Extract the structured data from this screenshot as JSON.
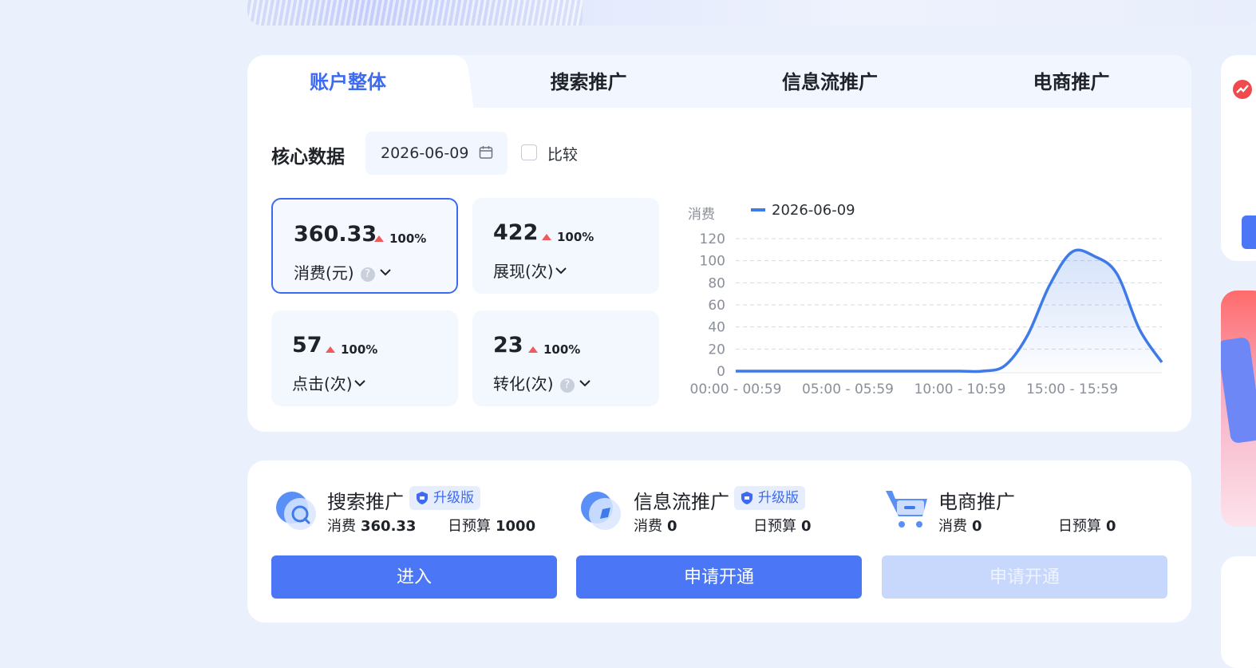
{
  "tabs": [
    {
      "label": "账户整体",
      "active": true
    },
    {
      "label": "搜索推广",
      "active": false
    },
    {
      "label": "信息流推广",
      "active": false
    },
    {
      "label": "电商推广",
      "active": false
    }
  ],
  "core": {
    "title": "核心数据",
    "date": "2026-06-09",
    "compare_label": "比较"
  },
  "metrics": [
    {
      "value": "360.33",
      "change": "100%",
      "label": "消费(元)",
      "help": "?",
      "selected": true
    },
    {
      "value": "422",
      "change": "100%",
      "label": "展现(次)",
      "selected": false
    },
    {
      "value": "57",
      "change": "100%",
      "label": "点击(次)",
      "selected": false
    },
    {
      "value": "23",
      "change": "100%",
      "label": "转化(次)",
      "help": "?",
      "selected": false
    }
  ],
  "chart_data": {
    "type": "line",
    "ylabel": "消费",
    "legend": "top-left",
    "series": [
      {
        "name": "2026-06-09",
        "color": "#3f7be8",
        "values": [
          0,
          0,
          0,
          0,
          0,
          0,
          0,
          0,
          0,
          0,
          0,
          0,
          5,
          32,
          78,
          108,
          104,
          88,
          38,
          8
        ]
      }
    ],
    "x_ticks": [
      "00:00 - 00:59",
      "05:00 - 05:59",
      "10:00 - 10:59",
      "15:00 - 15:59"
    ],
    "y_ticks": [
      "0",
      "20",
      "40",
      "60",
      "80",
      "100",
      "120"
    ],
    "ylim": [
      0,
      120
    ],
    "grid": true
  },
  "products": [
    {
      "name": "搜索推广",
      "icon": "search-promo-icon",
      "badge": "升级版",
      "spend_label": "消费",
      "spend": "360.33",
      "budget_label": "日预算",
      "budget": "1000",
      "button": "进入",
      "button_disabled": false
    },
    {
      "name": "信息流推广",
      "icon": "feed-promo-icon",
      "badge": "升级版",
      "spend_label": "消费",
      "spend": "0",
      "budget_label": "日预算",
      "budget": "0",
      "button": "申请开通",
      "button_disabled": false
    },
    {
      "name": "电商推广",
      "icon": "cart-icon",
      "spend_label": "消费",
      "spend": "0",
      "budget_label": "日预算",
      "budget": "0",
      "button": "申请开通",
      "button_disabled": true
    }
  ],
  "colors": {
    "accent": "#3d6bf0",
    "button": "#4b77f7",
    "button_disabled": "#c7d8fc",
    "increase": "#f05a5a"
  }
}
